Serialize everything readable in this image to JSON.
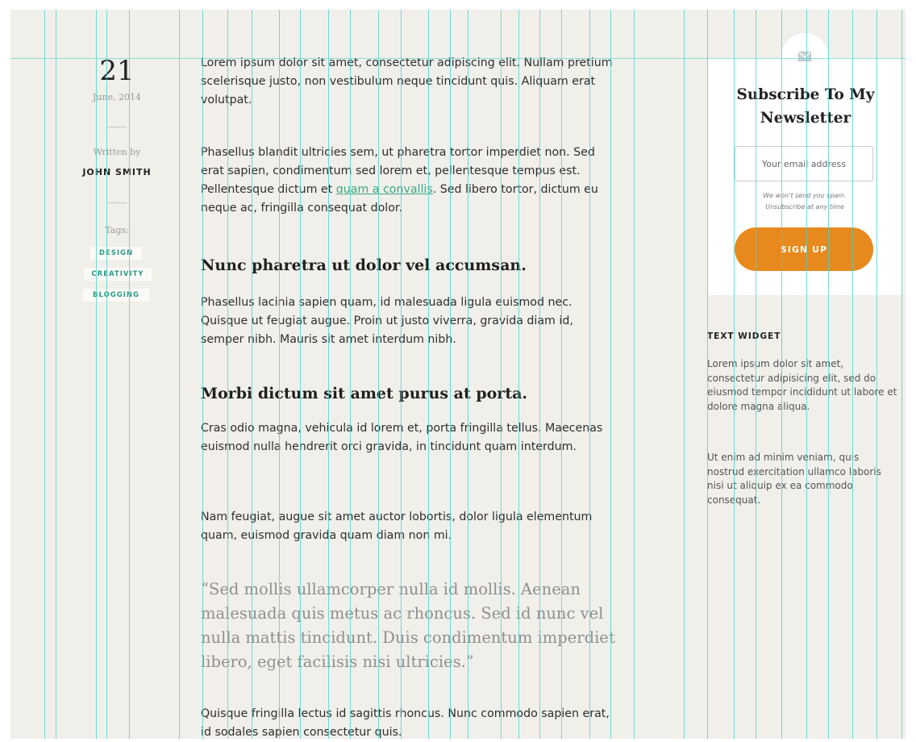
{
  "post_meta": {
    "day": "21",
    "month_year": "June, 2014",
    "written_by_label": "Written by",
    "author": "JOHN SMITH",
    "tags_label": "Tags:",
    "tags": [
      "DESIGN",
      "CREATIVITY",
      "BLOGGING"
    ]
  },
  "article": {
    "p1": "Lorem ipsum dolor sit amet, consectetur adipiscing elit. Nullam pretium scelerisque justo, non vestibulum neque tincidunt quis. Aliquam erat volutpat.",
    "p2_before": "Phasellus blandit ultricies sem, ut pharetra tortor imperdiet non. Sed erat sapien, condimentum sed lorem et, pellentesque tempus est. Pellentesque dictum et ",
    "p2_link": "quam a convallis",
    "p2_after": ". Sed libero tortor, dictum eu neque ac, fringilla consequat dolor.",
    "heading1": "Nunc pharetra ut dolor vel accumsan.",
    "p3": "Phasellus lacinia sapien quam, id malesuada ligula euismod nec. Quisque ut feugiat augue. Proin ut justo viverra, gravida diam id, semper nibh. Mauris sit amet interdum nibh.",
    "heading2": "Morbi dictum sit amet purus at porta.",
    "p4": "Cras odio magna, vehicula id lorem et, porta fringilla tellus. Maecenas euismod nulla hendrerit orci gravida, in tincidunt quam interdum.",
    "p5": "Nam feugiat, augue sit amet auctor lobortis, dolor ligula elementum quam, euismod gravida quam diam non mi.",
    "quote": "“Sed mollis ullamcorper nulla id mollis. Aenean malesuada quis metus ac rhoncus. Sed id nunc vel nulla mattis tincidunt. Duis condimentum imperdiet libero, eget facilisis nisi ultricies.”",
    "p6": "Quisque fringilla lectus id sagittis rhoncus. Nunc commodo sapien erat, id sodales sapien consectetur quis."
  },
  "newsletter": {
    "icon": "envelope-icon",
    "title": "Subscribe To My Newsletter",
    "email_placeholder": "Your email address",
    "spam_note_line1": "We won't send you spam.",
    "spam_note_line2": "Unsubscribe at any time",
    "signup_label": "SIGN UP"
  },
  "text_widget": {
    "title": "TEXT WIDGET",
    "p1": "Lorem ipsum dolor sit amet, consectetur adipisicing elit, sed do eiusmod tempor incididunt ut labore et dolore magna aliqua.",
    "p2": "Ut enim ad minim veniam, quis nostrud exercitation ullamco laboris nisi ut aliquip ex ea commodo consequat."
  },
  "colors": {
    "background": "#f1efea",
    "accent_green": "#3aa783",
    "button_orange": "#e8891d",
    "grid_overlay": "#40d3cc"
  }
}
